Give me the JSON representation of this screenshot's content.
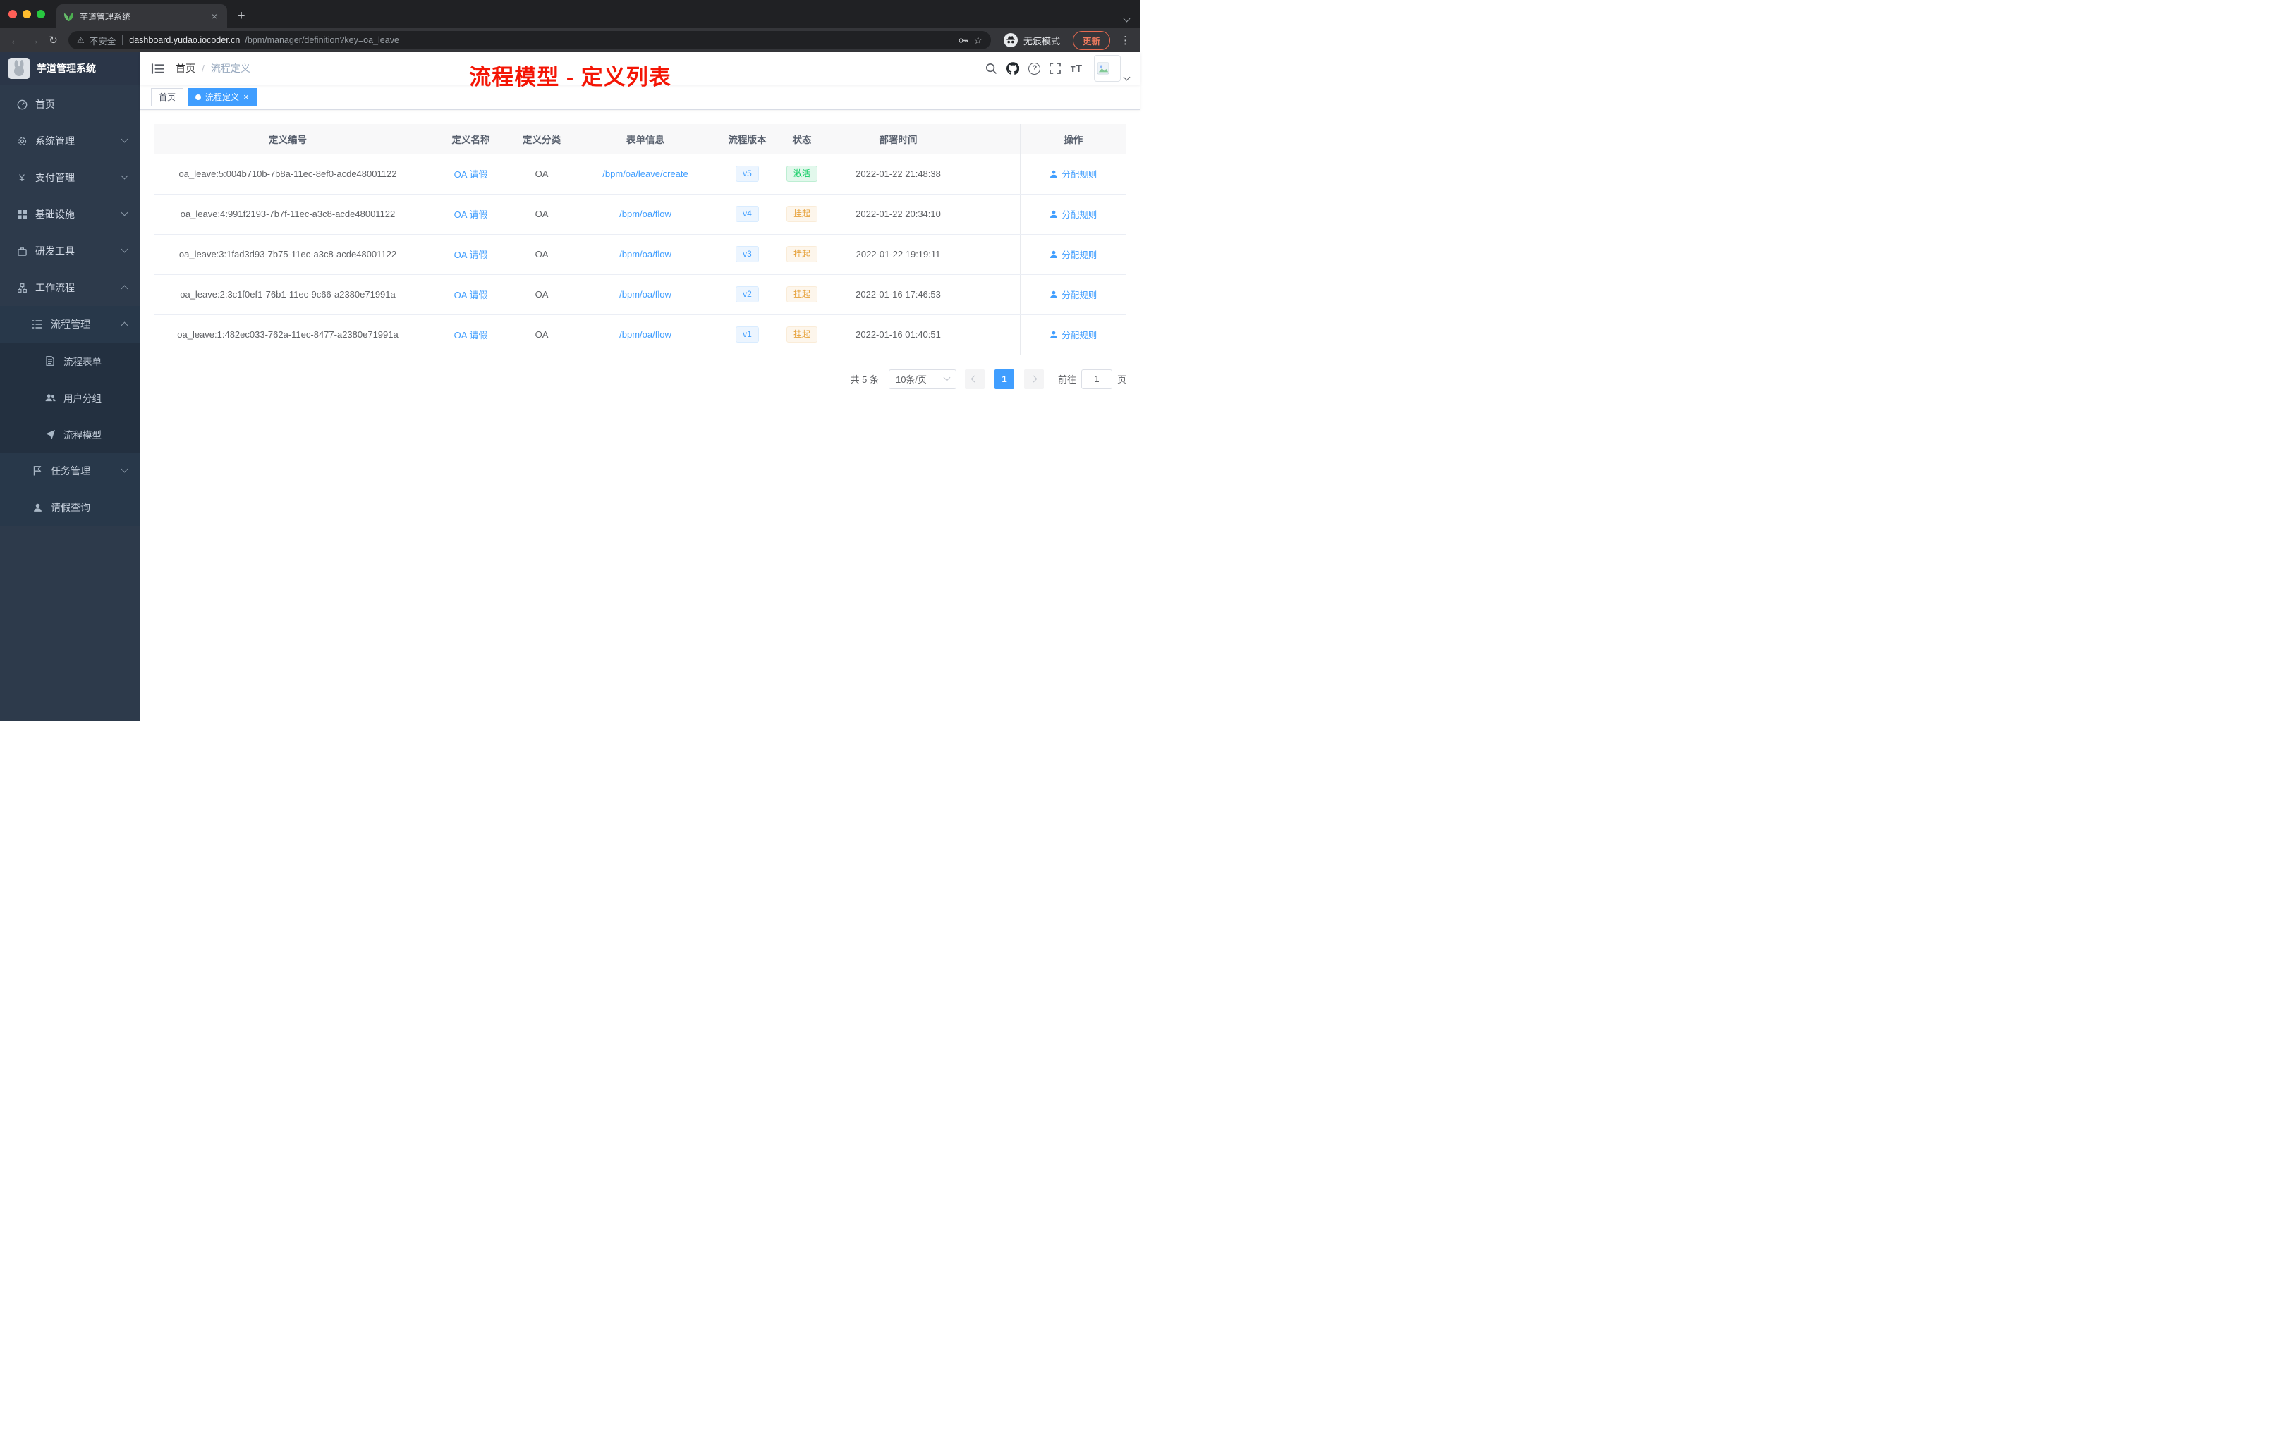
{
  "colors": {
    "accent": "#409eff",
    "success": "#13ce66",
    "warning": "#e6a23c",
    "annotation_red": "#f41505",
    "sidebar_bg": "#2d3a4b"
  },
  "icons": {
    "close": "×",
    "plus": "+",
    "back": "←",
    "forward": "→",
    "reload": "↻",
    "warning": "⚠",
    "star": "☆",
    "kebab": "⋮",
    "question": "?",
    "font_size": "тT"
  },
  "browser": {
    "tab_title": "芋道管理系统",
    "security_label": "不安全",
    "url_host": "dashboard.yudao.iocoder.cn",
    "url_path": "/bpm/manager/definition?key=oa_leave",
    "incognito_label": "无痕模式",
    "update_label": "更新"
  },
  "sidebar": {
    "logo_title": "芋道管理系统",
    "menu": [
      {
        "label": "首页"
      },
      {
        "label": "系统管理"
      },
      {
        "label": "支付管理"
      },
      {
        "label": "基础设施"
      },
      {
        "label": "研发工具"
      },
      {
        "label": "工作流程"
      },
      {
        "label": "流程管理"
      },
      {
        "label": "流程表单"
      },
      {
        "label": "用户分组"
      },
      {
        "label": "流程模型"
      },
      {
        "label": "任务管理"
      },
      {
        "label": "请假查询"
      }
    ]
  },
  "header": {
    "breadcrumb": [
      "首页",
      "流程定义"
    ],
    "breadcrumb_separator": "/",
    "annotation": "流程模型 - 定义列表"
  },
  "tags": [
    {
      "label": "首页"
    },
    {
      "label": "流程定义"
    }
  ],
  "table": {
    "columns": [
      "定义编号",
      "定义名称",
      "定义分类",
      "表单信息",
      "流程版本",
      "状态",
      "部署时间",
      "操作"
    ],
    "rows": [
      {
        "id": "oa_leave:5:004b710b-7b8a-11ec-8ef0-acde48001122",
        "name": "OA 请假",
        "category": "OA",
        "form": "/bpm/oa/leave/create",
        "version": "v5",
        "status": "激活",
        "status_type": "active",
        "deploy_time": "2022-01-22 21:48:38",
        "action": "分配规则"
      },
      {
        "id": "oa_leave:4:991f2193-7b7f-11ec-a3c8-acde48001122",
        "name": "OA 请假",
        "category": "OA",
        "form": "/bpm/oa/flow",
        "version": "v4",
        "status": "挂起",
        "status_type": "suspended",
        "deploy_time": "2022-01-22 20:34:10",
        "action": "分配规则"
      },
      {
        "id": "oa_leave:3:1fad3d93-7b75-11ec-a3c8-acde48001122",
        "name": "OA 请假",
        "category": "OA",
        "form": "/bpm/oa/flow",
        "version": "v3",
        "status": "挂起",
        "status_type": "suspended",
        "deploy_time": "2022-01-22 19:19:11",
        "action": "分配规则"
      },
      {
        "id": "oa_leave:2:3c1f0ef1-76b1-11ec-9c66-a2380e71991a",
        "name": "OA 请假",
        "category": "OA",
        "form": "/bpm/oa/flow",
        "version": "v2",
        "status": "挂起",
        "status_type": "suspended",
        "deploy_time": "2022-01-16 17:46:53",
        "action": "分配规则"
      },
      {
        "id": "oa_leave:1:482ec033-762a-11ec-8477-a2380e71991a",
        "name": "OA 请假",
        "category": "OA",
        "form": "/bpm/oa/flow",
        "version": "v1",
        "status": "挂起",
        "status_type": "suspended",
        "deploy_time": "2022-01-16 01:40:51",
        "action": "分配规则"
      }
    ]
  },
  "pagination": {
    "total": "共 5 条",
    "page_size": "10条/页",
    "current_page": "1",
    "goto_label": "前往",
    "goto_value": "1",
    "page_unit": "页"
  }
}
